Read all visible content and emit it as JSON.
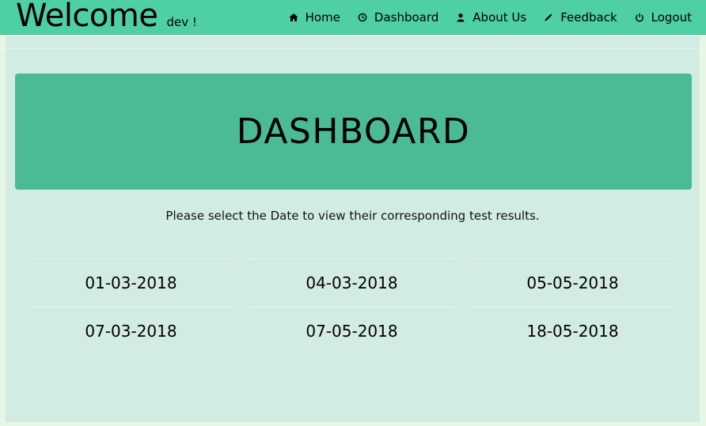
{
  "header": {
    "brand_title": "Welcome",
    "brand_user": "dev !",
    "nav": [
      {
        "label": "Home",
        "icon": "home-icon"
      },
      {
        "label": "Dashboard",
        "icon": "dashboard-icon"
      },
      {
        "label": "About Us",
        "icon": "user-icon"
      },
      {
        "label": "Feedback",
        "icon": "pencil-icon"
      },
      {
        "label": "Logout",
        "icon": "power-icon"
      }
    ]
  },
  "main": {
    "title": "DASHBOARD",
    "instruction": "Please select the Date to view their corresponding test results.",
    "dates": [
      "01-03-2018",
      "04-03-2018",
      "05-05-2018",
      "07-03-2018",
      "07-05-2018",
      "18-05-2018"
    ]
  },
  "colors": {
    "navbar": "#4ecfa6",
    "page_background": "#d3ece3",
    "jumbotron": "#4abb95"
  }
}
